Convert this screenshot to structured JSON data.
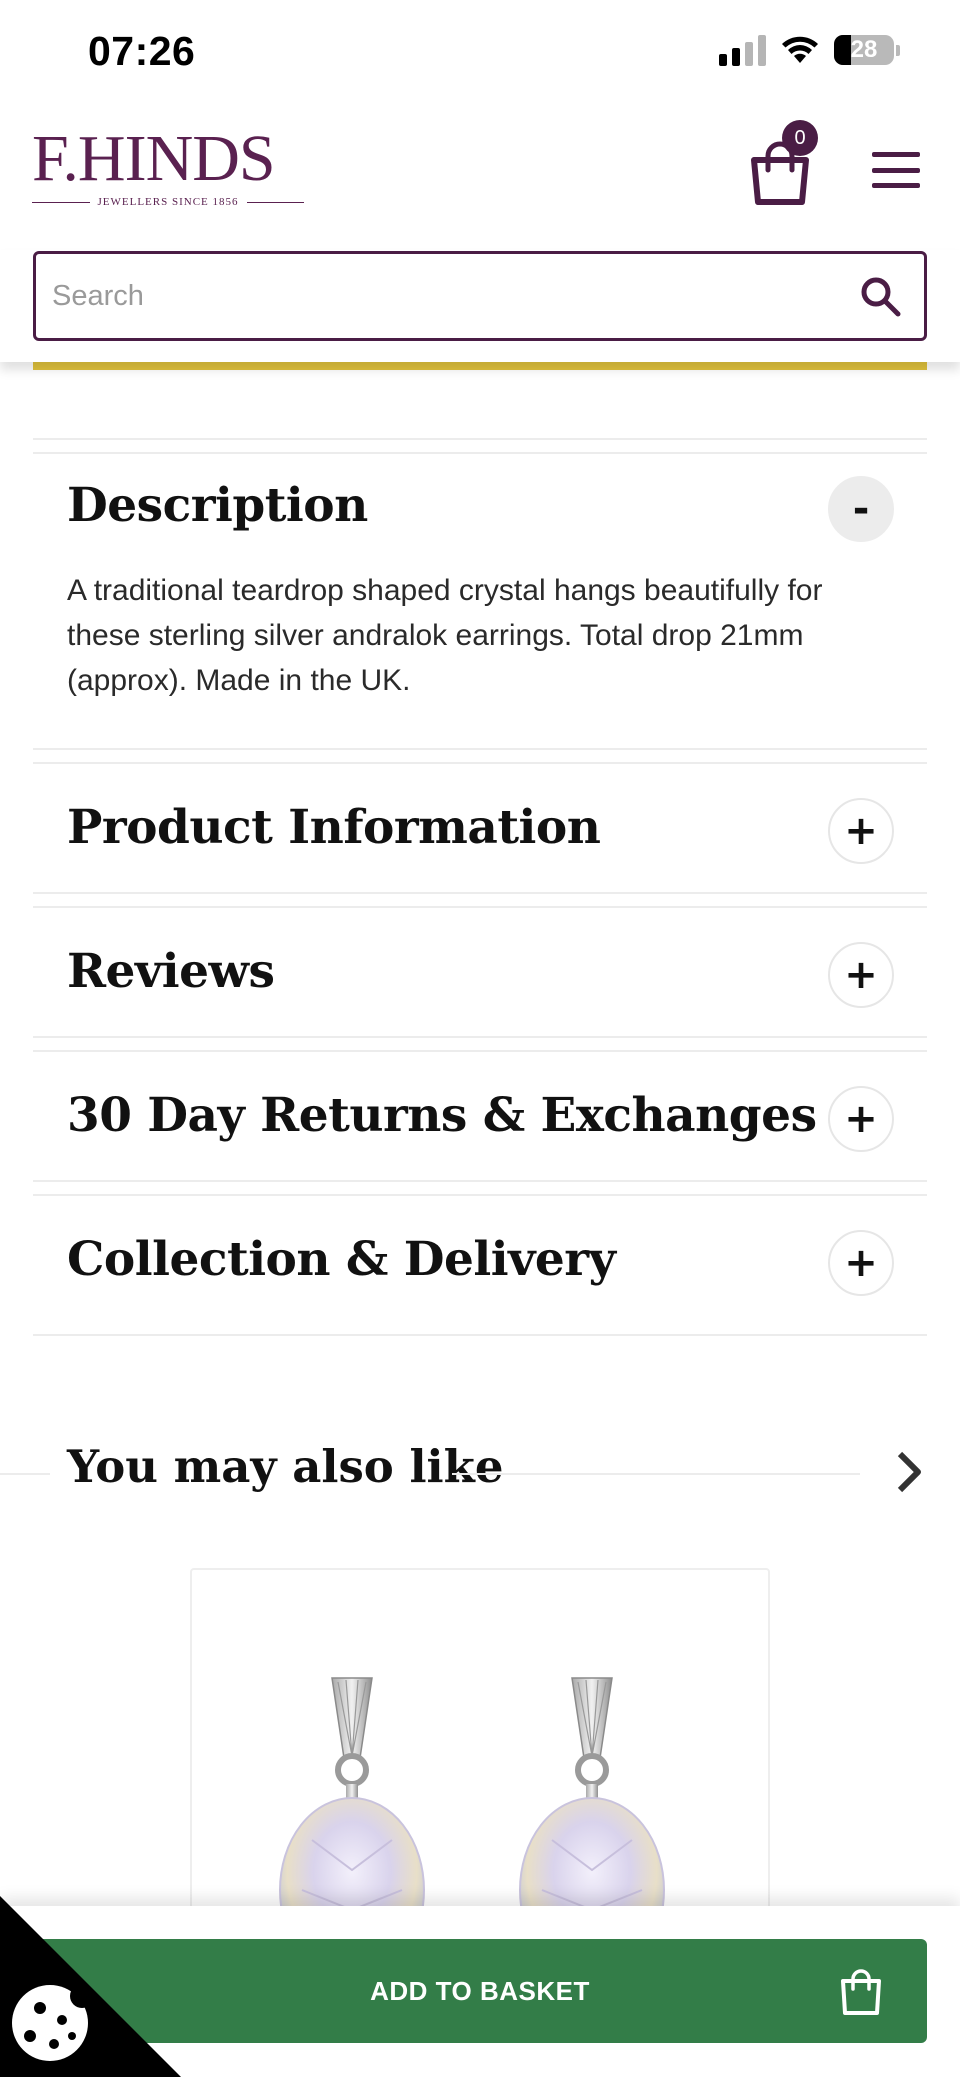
{
  "status_bar": {
    "time": "07:26",
    "battery": "28"
  },
  "header": {
    "logo_main": "F.HINDS",
    "logo_sub": "JEWELLERS SINCE 1856",
    "basket_count": "0"
  },
  "search": {
    "placeholder": "Search"
  },
  "accordion": [
    {
      "title": "Description",
      "toggle": "-",
      "expanded": true,
      "body": "A traditional teardrop shaped crystal hangs beautifully for these sterling silver andralok earrings. Total drop 21mm (approx). Made in the UK."
    },
    {
      "title": "Product Information",
      "toggle": "+",
      "expanded": false
    },
    {
      "title": "Reviews",
      "toggle": "+",
      "expanded": false
    },
    {
      "title": "30 Day Returns & Exchanges",
      "toggle": "+",
      "expanded": false
    },
    {
      "title": "Collection & Delivery",
      "toggle": "+",
      "expanded": false
    }
  ],
  "recommendations": {
    "title": "You may also like"
  },
  "cta": {
    "label": "ADD TO BASKET"
  },
  "colors": {
    "brand": "#4a1d45",
    "cta": "#337d48"
  }
}
